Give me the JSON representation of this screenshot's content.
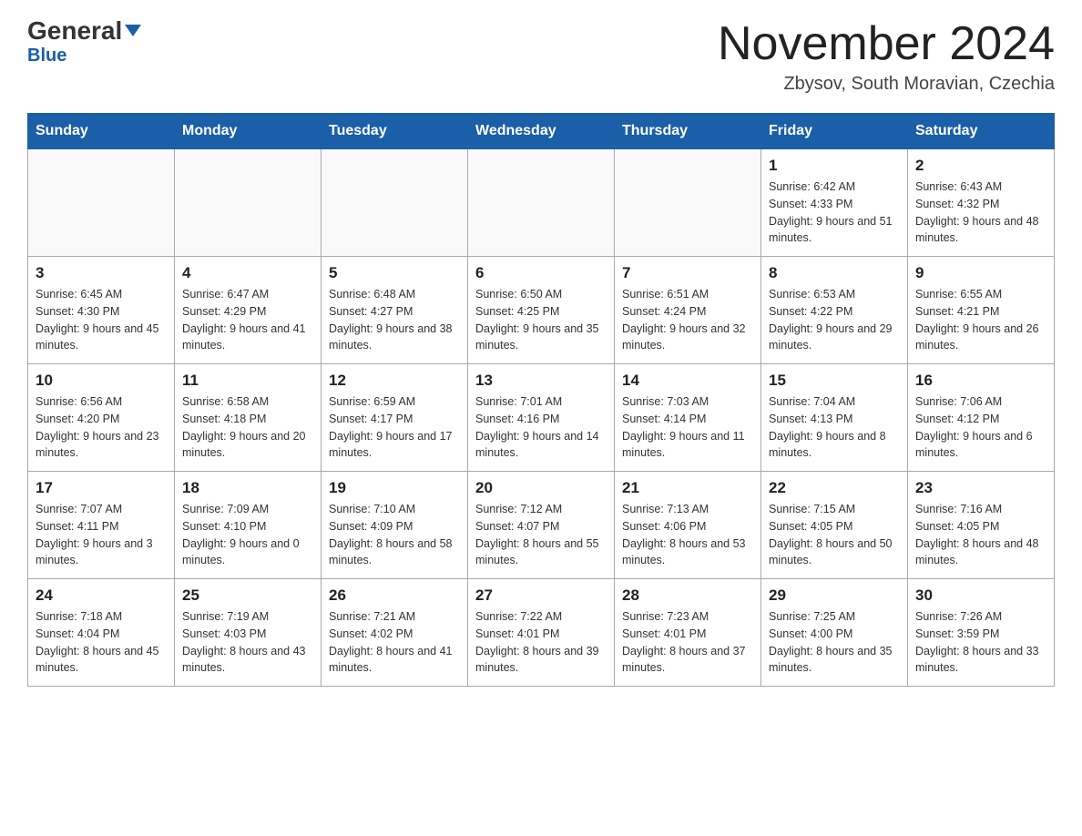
{
  "header": {
    "logo_main": "General",
    "logo_sub": "Blue",
    "month_title": "November 2024",
    "location": "Zbysov, South Moravian, Czechia"
  },
  "weekdays": [
    "Sunday",
    "Monday",
    "Tuesday",
    "Wednesday",
    "Thursday",
    "Friday",
    "Saturday"
  ],
  "weeks": [
    [
      {
        "day": "",
        "info": ""
      },
      {
        "day": "",
        "info": ""
      },
      {
        "day": "",
        "info": ""
      },
      {
        "day": "",
        "info": ""
      },
      {
        "day": "",
        "info": ""
      },
      {
        "day": "1",
        "info": "Sunrise: 6:42 AM\nSunset: 4:33 PM\nDaylight: 9 hours and 51 minutes."
      },
      {
        "day": "2",
        "info": "Sunrise: 6:43 AM\nSunset: 4:32 PM\nDaylight: 9 hours and 48 minutes."
      }
    ],
    [
      {
        "day": "3",
        "info": "Sunrise: 6:45 AM\nSunset: 4:30 PM\nDaylight: 9 hours and 45 minutes."
      },
      {
        "day": "4",
        "info": "Sunrise: 6:47 AM\nSunset: 4:29 PM\nDaylight: 9 hours and 41 minutes."
      },
      {
        "day": "5",
        "info": "Sunrise: 6:48 AM\nSunset: 4:27 PM\nDaylight: 9 hours and 38 minutes."
      },
      {
        "day": "6",
        "info": "Sunrise: 6:50 AM\nSunset: 4:25 PM\nDaylight: 9 hours and 35 minutes."
      },
      {
        "day": "7",
        "info": "Sunrise: 6:51 AM\nSunset: 4:24 PM\nDaylight: 9 hours and 32 minutes."
      },
      {
        "day": "8",
        "info": "Sunrise: 6:53 AM\nSunset: 4:22 PM\nDaylight: 9 hours and 29 minutes."
      },
      {
        "day": "9",
        "info": "Sunrise: 6:55 AM\nSunset: 4:21 PM\nDaylight: 9 hours and 26 minutes."
      }
    ],
    [
      {
        "day": "10",
        "info": "Sunrise: 6:56 AM\nSunset: 4:20 PM\nDaylight: 9 hours and 23 minutes."
      },
      {
        "day": "11",
        "info": "Sunrise: 6:58 AM\nSunset: 4:18 PM\nDaylight: 9 hours and 20 minutes."
      },
      {
        "day": "12",
        "info": "Sunrise: 6:59 AM\nSunset: 4:17 PM\nDaylight: 9 hours and 17 minutes."
      },
      {
        "day": "13",
        "info": "Sunrise: 7:01 AM\nSunset: 4:16 PM\nDaylight: 9 hours and 14 minutes."
      },
      {
        "day": "14",
        "info": "Sunrise: 7:03 AM\nSunset: 4:14 PM\nDaylight: 9 hours and 11 minutes."
      },
      {
        "day": "15",
        "info": "Sunrise: 7:04 AM\nSunset: 4:13 PM\nDaylight: 9 hours and 8 minutes."
      },
      {
        "day": "16",
        "info": "Sunrise: 7:06 AM\nSunset: 4:12 PM\nDaylight: 9 hours and 6 minutes."
      }
    ],
    [
      {
        "day": "17",
        "info": "Sunrise: 7:07 AM\nSunset: 4:11 PM\nDaylight: 9 hours and 3 minutes."
      },
      {
        "day": "18",
        "info": "Sunrise: 7:09 AM\nSunset: 4:10 PM\nDaylight: 9 hours and 0 minutes."
      },
      {
        "day": "19",
        "info": "Sunrise: 7:10 AM\nSunset: 4:09 PM\nDaylight: 8 hours and 58 minutes."
      },
      {
        "day": "20",
        "info": "Sunrise: 7:12 AM\nSunset: 4:07 PM\nDaylight: 8 hours and 55 minutes."
      },
      {
        "day": "21",
        "info": "Sunrise: 7:13 AM\nSunset: 4:06 PM\nDaylight: 8 hours and 53 minutes."
      },
      {
        "day": "22",
        "info": "Sunrise: 7:15 AM\nSunset: 4:05 PM\nDaylight: 8 hours and 50 minutes."
      },
      {
        "day": "23",
        "info": "Sunrise: 7:16 AM\nSunset: 4:05 PM\nDaylight: 8 hours and 48 minutes."
      }
    ],
    [
      {
        "day": "24",
        "info": "Sunrise: 7:18 AM\nSunset: 4:04 PM\nDaylight: 8 hours and 45 minutes."
      },
      {
        "day": "25",
        "info": "Sunrise: 7:19 AM\nSunset: 4:03 PM\nDaylight: 8 hours and 43 minutes."
      },
      {
        "day": "26",
        "info": "Sunrise: 7:21 AM\nSunset: 4:02 PM\nDaylight: 8 hours and 41 minutes."
      },
      {
        "day": "27",
        "info": "Sunrise: 7:22 AM\nSunset: 4:01 PM\nDaylight: 8 hours and 39 minutes."
      },
      {
        "day": "28",
        "info": "Sunrise: 7:23 AM\nSunset: 4:01 PM\nDaylight: 8 hours and 37 minutes."
      },
      {
        "day": "29",
        "info": "Sunrise: 7:25 AM\nSunset: 4:00 PM\nDaylight: 8 hours and 35 minutes."
      },
      {
        "day": "30",
        "info": "Sunrise: 7:26 AM\nSunset: 3:59 PM\nDaylight: 8 hours and 33 minutes."
      }
    ]
  ]
}
